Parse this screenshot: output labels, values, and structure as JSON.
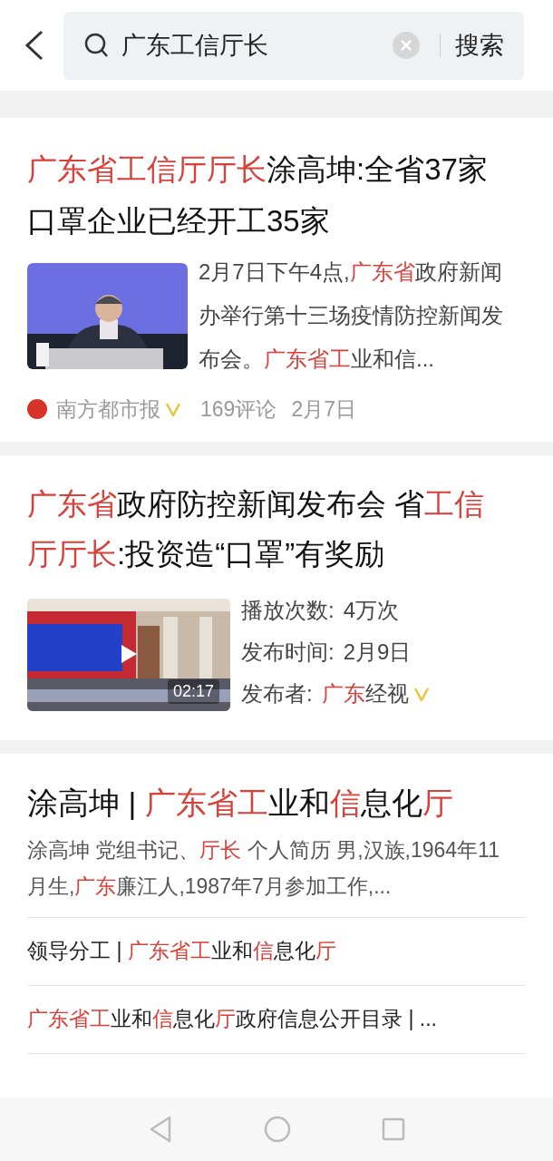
{
  "search": {
    "query": "广东工信厅长",
    "button": "搜索"
  },
  "results": [
    {
      "kind": "article",
      "title": [
        {
          "text": "广东省工信厅厅长",
          "highlight": true
        },
        {
          "text": "涂高坤:全省37家口罩企业已经开工35家",
          "highlight": false
        }
      ],
      "snippet": [
        {
          "text": "2月7日下午4点,",
          "highlight": false
        },
        {
          "text": "广东省",
          "highlight": true
        },
        {
          "text": "政府新闻办举行第十三场疫情防控新闻发布会。",
          "highlight": false
        },
        {
          "text": "广东省工",
          "highlight": true
        },
        {
          "text": "业和信...",
          "highlight": false
        }
      ],
      "source": "南方都市报",
      "verified": true,
      "comments": "169评论",
      "date": "2月7日"
    },
    {
      "kind": "video",
      "title": [
        {
          "text": "广东省",
          "highlight": true
        },
        {
          "text": "政府防控新闻发布会 省",
          "highlight": false
        },
        {
          "text": "工信厅厅长",
          "highlight": true
        },
        {
          "text": ":投资造“口罩”有奖励",
          "highlight": false
        }
      ],
      "duration": "02:17",
      "meta": [
        {
          "label": "播放次数:",
          "value": [
            {
              "text": "4万次",
              "highlight": false
            }
          ],
          "verified": false
        },
        {
          "label": "发布时间:",
          "value": [
            {
              "text": "2月9日",
              "highlight": false
            }
          ],
          "verified": false
        },
        {
          "label": "发布者:",
          "value": [
            {
              "text": "广东",
              "highlight": true
            },
            {
              "text": "经视",
              "highlight": false
            }
          ],
          "verified": true
        }
      ]
    },
    {
      "kind": "site",
      "title": [
        {
          "text": "涂高坤 | ",
          "highlight": false
        },
        {
          "text": "广东省工",
          "highlight": true
        },
        {
          "text": "业和",
          "highlight": false
        },
        {
          "text": "信",
          "highlight": true
        },
        {
          "text": "息化",
          "highlight": false
        },
        {
          "text": "厅",
          "highlight": true
        }
      ],
      "snippet": [
        {
          "text": "涂高坤 党组书记、",
          "highlight": false
        },
        {
          "text": "厅长",
          "highlight": true
        },
        {
          "text": " 个人简历 男,汉族,1964年11月生,",
          "highlight": false
        },
        {
          "text": "广东",
          "highlight": true
        },
        {
          "text": "廉江人,1987年7月参加工作,...",
          "highlight": false
        }
      ],
      "links": [
        [
          {
            "text": "领导分工 | ",
            "highlight": false
          },
          {
            "text": "广东省工",
            "highlight": true
          },
          {
            "text": "业和",
            "highlight": false
          },
          {
            "text": "信",
            "highlight": true
          },
          {
            "text": "息化",
            "highlight": false
          },
          {
            "text": "厅",
            "highlight": true
          }
        ],
        [
          {
            "text": "广东省工",
            "highlight": true
          },
          {
            "text": "业和",
            "highlight": false
          },
          {
            "text": "信",
            "highlight": true
          },
          {
            "text": "息化",
            "highlight": false
          },
          {
            "text": "厅",
            "highlight": true
          },
          {
            "text": "政府信息公开目录 | ...",
            "highlight": false
          }
        ]
      ]
    }
  ]
}
